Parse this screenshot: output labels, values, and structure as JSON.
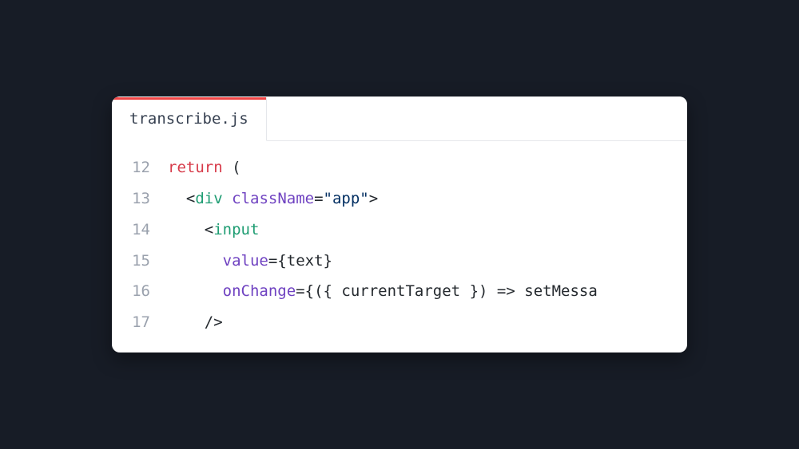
{
  "tab": {
    "filename": "transcribe.js"
  },
  "code": {
    "lines": [
      {
        "num": "12",
        "indent": "",
        "tokens": [
          {
            "t": "return",
            "c": "tk-keyword"
          },
          {
            "t": " (",
            "c": "tk-plain"
          }
        ]
      },
      {
        "num": "13",
        "indent": "  ",
        "tokens": [
          {
            "t": "<",
            "c": "tk-punc"
          },
          {
            "t": "div",
            "c": "tk-tag"
          },
          {
            "t": " ",
            "c": "tk-plain"
          },
          {
            "t": "className",
            "c": "tk-attr"
          },
          {
            "t": "=",
            "c": "tk-punc"
          },
          {
            "t": "\"app\"",
            "c": "tk-str"
          },
          {
            "t": ">",
            "c": "tk-punc"
          }
        ]
      },
      {
        "num": "14",
        "indent": "    ",
        "tokens": [
          {
            "t": "<",
            "c": "tk-punc"
          },
          {
            "t": "input",
            "c": "tk-tag"
          }
        ]
      },
      {
        "num": "15",
        "indent": "      ",
        "tokens": [
          {
            "t": "value",
            "c": "tk-attr"
          },
          {
            "t": "=",
            "c": "tk-punc"
          },
          {
            "t": "{",
            "c": "tk-brace"
          },
          {
            "t": "text",
            "c": "tk-plain"
          },
          {
            "t": "}",
            "c": "tk-brace"
          }
        ]
      },
      {
        "num": "16",
        "indent": "      ",
        "tokens": [
          {
            "t": "onChange",
            "c": "tk-attr"
          },
          {
            "t": "=",
            "c": "tk-punc"
          },
          {
            "t": "{",
            "c": "tk-brace"
          },
          {
            "t": "(",
            "c": "tk-punc"
          },
          {
            "t": "{ ",
            "c": "tk-brace"
          },
          {
            "t": "currentTarget",
            "c": "tk-plain"
          },
          {
            "t": " }",
            "c": "tk-brace"
          },
          {
            "t": ")",
            "c": "tk-punc"
          },
          {
            "t": " ",
            "c": "tk-plain"
          },
          {
            "t": "=>",
            "c": "tk-punc"
          },
          {
            "t": " setMessa",
            "c": "tk-plain"
          }
        ]
      },
      {
        "num": "17",
        "indent": "    ",
        "tokens": [
          {
            "t": "/>",
            "c": "tk-punc"
          }
        ]
      }
    ]
  }
}
